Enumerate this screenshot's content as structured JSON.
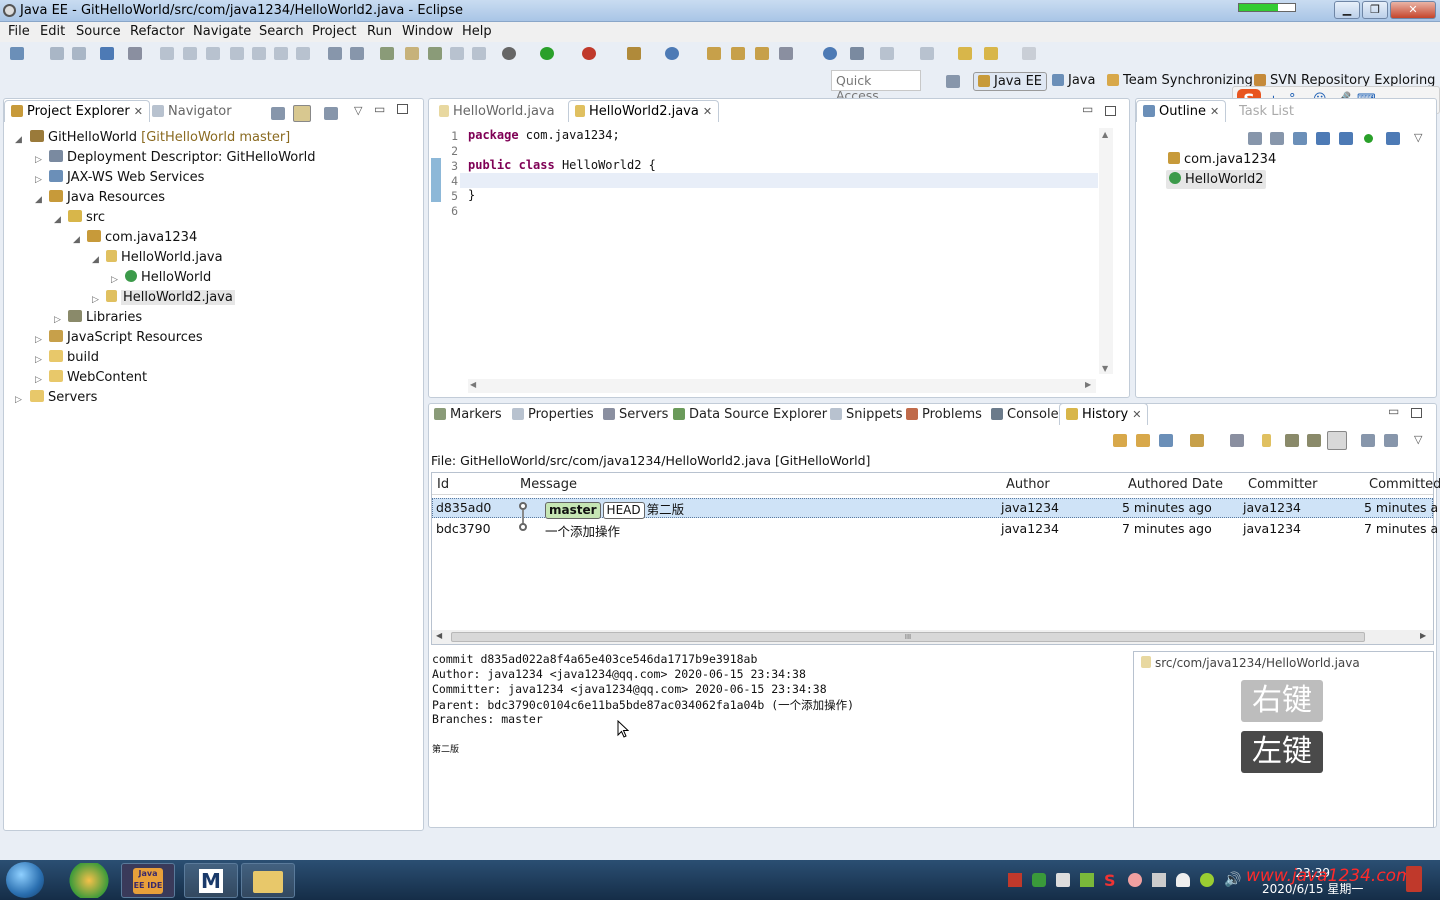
{
  "window": {
    "title": "Java EE - GitHelloWorld/src/com/java1234/HelloWorld2.java - Eclipse"
  },
  "menu": [
    "File",
    "Edit",
    "Source",
    "Refactor",
    "Navigate",
    "Search",
    "Project",
    "Run",
    "Window",
    "Help"
  ],
  "quick_access": {
    "placeholder": "Quick Access"
  },
  "perspectives": [
    "Java EE",
    "Java",
    "Team Synchronizing",
    "SVN Repository Exploring"
  ],
  "left_tabs": {
    "project_explorer": "Project Explorer",
    "navigator": "Navigator"
  },
  "tree": {
    "project": "GitHelloWorld",
    "project_decoration": "[GitHelloWorld master]",
    "deployment": "Deployment Descriptor: GitHelloWorld",
    "jaxws": "JAX-WS Web Services",
    "java_resources": "Java Resources",
    "src": "src",
    "package": "com.java1234",
    "file1": "HelloWorld.java",
    "class1": "HelloWorld",
    "file2": "HelloWorld2.java",
    "libraries": "Libraries",
    "js_resources": "JavaScript Resources",
    "build": "build",
    "webcontent": "WebContent",
    "servers": "Servers"
  },
  "editor": {
    "tabs": [
      "HelloWorld.java",
      "HelloWorld2.java"
    ],
    "line_numbers": [
      "1",
      "2",
      "3",
      "4",
      "5",
      "6"
    ],
    "line1_kw": "package",
    "line1_rest": " com.java1234;",
    "line3_kw1": "public",
    "line3_kw2": "class",
    "line3_rest": " HelloWorld2 {",
    "line5": "}"
  },
  "outline": {
    "tabs": [
      "Outline",
      "Task List"
    ],
    "items": [
      "com.java1234",
      "HelloWorld2"
    ]
  },
  "bottom_tabs": [
    "Markers",
    "Properties",
    "Servers",
    "Data Source Explorer",
    "Snippets",
    "Problems",
    "Console",
    "History"
  ],
  "history": {
    "file_label": "File: GitHelloWorld/src/com/java1234/HelloWorld2.java [GitHelloWorld]",
    "columns": [
      "Id",
      "Message",
      "Author",
      "Authored Date",
      "Committer",
      "Committed"
    ],
    "rows": [
      {
        "id": "d835ad0",
        "ref1": "master",
        "ref2": "HEAD",
        "message": "第二版",
        "author": "java1234",
        "authored": "5 minutes ago",
        "committer": "java1234",
        "committed": "5 minutes a"
      },
      {
        "id": "bdc3790",
        "message": "一个添加操作",
        "author": "java1234",
        "authored": "7 minutes ago",
        "committer": "java1234",
        "committed": "7 minutes a"
      }
    ],
    "scroll_grip": "III",
    "details": [
      "commit d835ad022a8f4a65e403ce546da1717b9e3918ab",
      "Author: java1234 <java1234@qq.com> 2020-06-15 23:34:38",
      "Committer: java1234 <java1234@qq.com> 2020-06-15 23:34:38",
      "Parent: bdc3790c0104c6e11ba5bde87ac034062fa1a04b (一个添加操作)",
      "Branches: master",
      "第二版"
    ],
    "file_path": "src/com/java1234/HelloWorld.java",
    "key_right": "右键",
    "key_left": "左键"
  },
  "taskbar": {
    "clock_time": "23:39",
    "clock_date": "2020/6/15 星期一",
    "watermark": "www.java1234.com",
    "app_label": "Java EE IDE"
  }
}
